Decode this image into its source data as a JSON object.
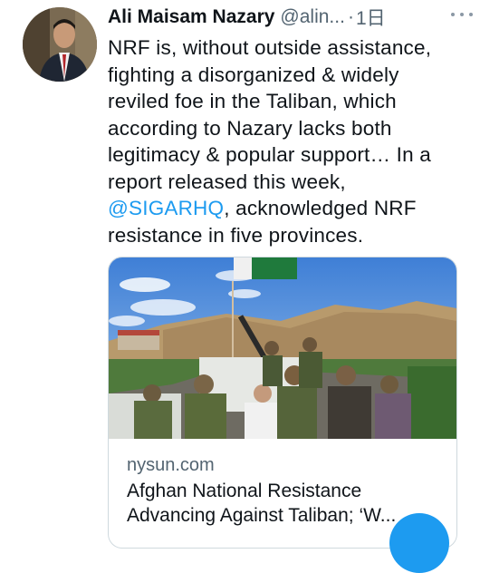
{
  "tweet": {
    "display_name": "Ali Maisam Nazary",
    "handle": "@alin...",
    "dot": "·",
    "time": "1日",
    "text_lines": [
      "NRF is, without outside assistance,",
      "fighting a disorganized & widely",
      "reviled foe in the Taliban, which",
      "according to Nazary lacks both",
      "legitimacy & popular support… In a",
      "report released this week,"
    ],
    "mention": "@SIGARHQ",
    "line7_rest": ", acknowledged NRF",
    "line8": "resistance in five provinces."
  },
  "card": {
    "domain": "nysun.com",
    "title_line1": "Afghan National Resistance",
    "title_line2": "Advancing Against Taliban; ‘W..."
  },
  "colors": {
    "accent": "#1d9bf0",
    "text": "#0f1419",
    "secondary": "#536471"
  }
}
